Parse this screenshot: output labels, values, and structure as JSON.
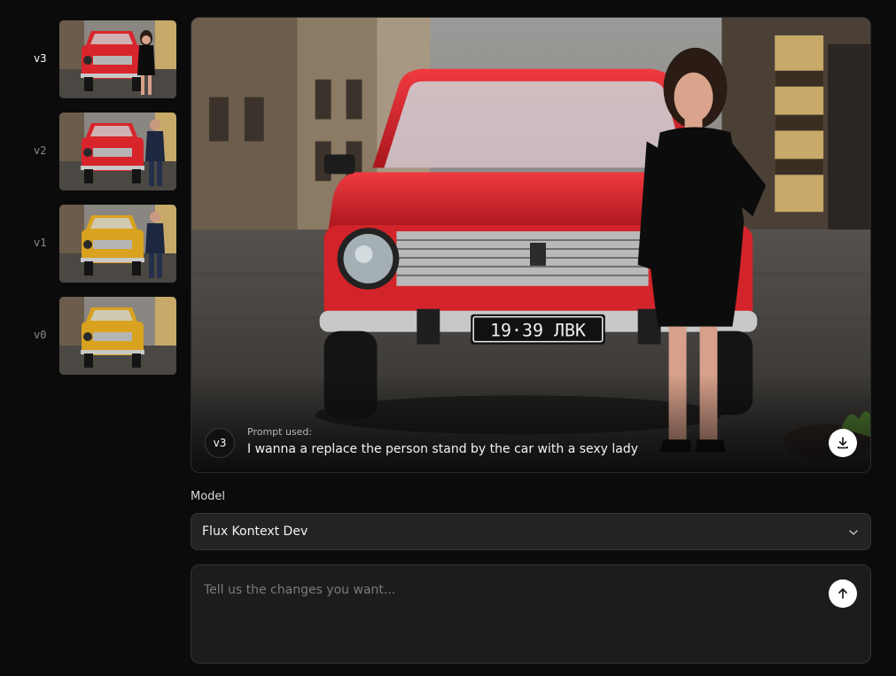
{
  "versions": [
    {
      "label": "v3",
      "active": true,
      "car_color": "#d8242b",
      "person": "woman"
    },
    {
      "label": "v2",
      "active": false,
      "car_color": "#d8242b",
      "person": "man"
    },
    {
      "label": "v1",
      "active": false,
      "car_color": "#d9a21f",
      "person": "man"
    },
    {
      "label": "v0",
      "active": false,
      "car_color": "#d9a21f",
      "person": "none"
    }
  ],
  "preview": {
    "version_badge": "v3",
    "prompt_caption": "Prompt used:",
    "prompt_text": "I wanna a replace the person stand by the car with a sexy lady",
    "plate_text": "19·39 ЛВК",
    "car_color": "#e0262d",
    "icons": {
      "download": "download-icon"
    }
  },
  "model": {
    "label": "Model",
    "selected": "Flux Kontext Dev",
    "icons": {
      "dropdown": "chevron-down-icon"
    }
  },
  "prompt_input": {
    "placeholder": "Tell us the changes you want...",
    "value": "",
    "icons": {
      "send": "arrow-up-icon"
    }
  },
  "theme": {
    "background": "#0b0b0b",
    "surface": "#232323",
    "accent": "#ffffff"
  }
}
